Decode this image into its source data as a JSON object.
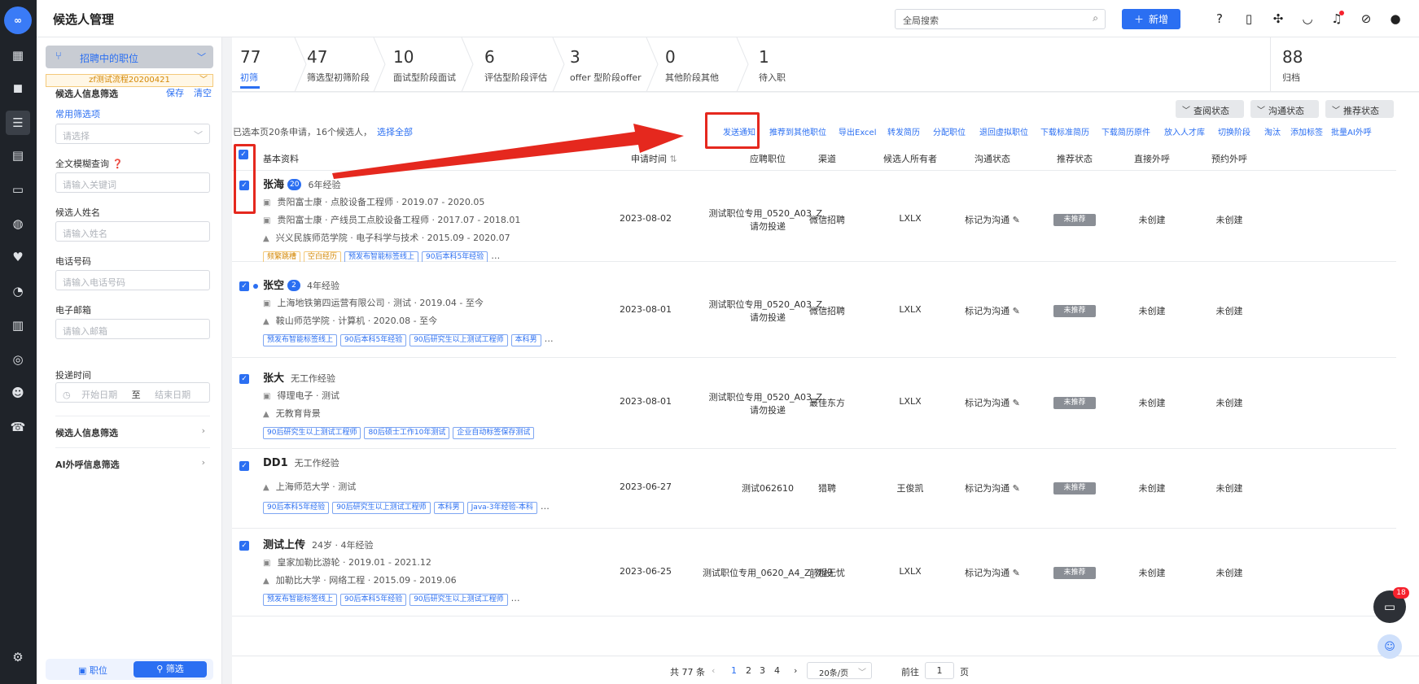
{
  "app": {
    "logo_text": "∞",
    "page_title": "候选人管理"
  },
  "rail": {
    "icons": [
      "dashboard-icon",
      "briefcase-icon",
      "resume-icon",
      "calendar-icon",
      "id-card-icon",
      "wechat-icon",
      "heart-icon",
      "pie-chart-icon",
      "bar-chart-icon",
      "compass-icon",
      "users-icon",
      "phone-icon",
      "settings-icon"
    ]
  },
  "topbar": {
    "search_placeholder": "全局搜索",
    "add_label": "新增",
    "icons": [
      "help-icon",
      "document-icon",
      "puzzle-icon",
      "headset-icon",
      "bell-icon",
      "link-icon",
      "user-icon"
    ]
  },
  "filter": {
    "job_selector": "招聘中的职位",
    "flow_tag": "zf测试流程20200421",
    "section_title": "候选人信息筛选",
    "save": "保存",
    "clear": "清空",
    "common_filters": "常用筛选项",
    "common_placeholder": "请选择",
    "fulltext_label": "全文模糊查询",
    "fulltext_placeholder": "请输入关键词",
    "name_label": "候选人姓名",
    "name_placeholder": "请输入姓名",
    "phone_label": "电话号码",
    "phone_placeholder": "请输入电话号码",
    "email_label": "电子邮箱",
    "email_placeholder": "请输入邮箱",
    "date_label": "投递时间",
    "date_start": "开始日期",
    "date_to": "至",
    "date_end": "结束日期",
    "section2": "候选人信息筛选",
    "section3": "AI外呼信息筛选",
    "bottom_tab_job": "职位",
    "bottom_tab_filter": "筛选"
  },
  "stages": [
    {
      "count": "77",
      "label": "初筛"
    },
    {
      "count": "47",
      "label": "筛选型初筛阶段"
    },
    {
      "count": "10",
      "label": "面试型阶段面试"
    },
    {
      "count": "6",
      "label": "评估型阶段评估"
    },
    {
      "count": "3",
      "label": "offer 型阶段offer"
    },
    {
      "count": "0",
      "label": "其他阶段其他"
    },
    {
      "count": "1",
      "label": "待入职"
    },
    {
      "count": "88",
      "label": "归档"
    }
  ],
  "status_filters": [
    "查阅状态",
    "沟通状态",
    "推荐状态"
  ],
  "selection": {
    "info": "已选本页20条申请，16个候选人，",
    "select_all": "选择全部"
  },
  "actions": [
    "发送通知",
    "推荐到其他职位",
    "导出Excel",
    "转发简历",
    "分配职位",
    "退回虚拟职位",
    "下载标准简历",
    "下载简历原件",
    "放入人才库",
    "切换阶段",
    "淘汰",
    "添加标签",
    "批量AI外呼"
  ],
  "columns": [
    "基本资料",
    "申请时间",
    "应聘职位",
    "渠道",
    "候选人所有者",
    "沟通状态",
    "推荐状态",
    "直接外呼",
    "预约外呼"
  ],
  "rows": [
    {
      "name": "张海",
      "badge": "20",
      "exp": "6年经验",
      "lines": [
        {
          "icon": "briefcase-icon",
          "text": "贵阳富士康 · 点胶设备工程师 · 2019.07 - 2020.05"
        },
        {
          "icon": "briefcase-icon",
          "text": "贵阳富士康 · 产线员工点胶设备工程师 · 2017.07 - 2018.01"
        },
        {
          "icon": "graduation-cap-icon",
          "text": "兴义民族师范学院 · 电子科学与技术 · 2015.09 - 2020.07"
        }
      ],
      "tags": [
        {
          "t": "频繁跳槽",
          "c": "or"
        },
        {
          "t": "空白经历",
          "c": "or"
        },
        {
          "t": "预发布智能标签线上",
          "c": ""
        },
        {
          "t": "90后本科5年经验",
          "c": ""
        }
      ],
      "date": "2023-08-02",
      "job": "测试职位专用_0520_A03_Z_请勿投递",
      "channel": "微信招聘",
      "owner": "LXLX",
      "comm": "标记为沟通",
      "rec": "未推荐",
      "direct": "未创建",
      "appt": "未创建"
    },
    {
      "name": "张空",
      "badge": "2",
      "exp": "4年经验",
      "lines": [
        {
          "icon": "briefcase-icon",
          "text": "上海地铁第四运营有限公司 · 测试 · 2019.04 - 至今"
        },
        {
          "icon": "graduation-cap-icon",
          "text": "鞍山师范学院 · 计算机 · 2020.08 - 至今"
        }
      ],
      "tags": [
        {
          "t": "预发布智能标签线上",
          "c": ""
        },
        {
          "t": "90后本科5年经验",
          "c": ""
        },
        {
          "t": "90后研究生以上测试工程师",
          "c": ""
        },
        {
          "t": "本科男",
          "c": ""
        }
      ],
      "date": "2023-08-01",
      "job": "测试职位专用_0520_A03_Z_请勿投递",
      "channel": "微信招聘",
      "owner": "LXLX",
      "comm": "标记为沟通",
      "rec": "未推荐",
      "direct": "未创建",
      "appt": "未创建"
    },
    {
      "name": "张大",
      "badge": "",
      "exp": "无工作经验",
      "lines": [
        {
          "icon": "briefcase-icon",
          "text": "得理电子 · 测试"
        },
        {
          "icon": "graduation-cap-icon",
          "text": "无教育背景"
        }
      ],
      "tags": [
        {
          "t": "90后研究生以上测试工程师",
          "c": ""
        },
        {
          "t": "80后硕士工作10年测试",
          "c": ""
        },
        {
          "t": "企业自动标签保存测试",
          "c": ""
        }
      ],
      "date": "2023-08-01",
      "job": "测试职位专用_0520_A03_Z_请勿投递",
      "channel": "最佳东方",
      "owner": "LXLX",
      "comm": "标记为沟通",
      "rec": "未推荐",
      "direct": "未创建",
      "appt": "未创建"
    },
    {
      "name": "DD1",
      "badge": "",
      "exp": "无工作经验",
      "lines": [
        {
          "icon": "graduation-cap-icon",
          "text": "上海师范大学 · 测试"
        }
      ],
      "tags": [
        {
          "t": "90后本科5年经验",
          "c": ""
        },
        {
          "t": "90后研究生以上测试工程师",
          "c": ""
        },
        {
          "t": "本科男",
          "c": ""
        },
        {
          "t": "Java-3年经验-本科",
          "c": ""
        }
      ],
      "date": "2023-06-27",
      "job": "测试062610",
      "channel": "猎聘",
      "owner": "王俊凯",
      "comm": "标记为沟通",
      "rec": "未推荐",
      "direct": "未创建",
      "appt": "未创建"
    },
    {
      "name": "测试上传",
      "badge": "",
      "exp": "24岁 · 4年经验",
      "lines": [
        {
          "icon": "briefcase-icon",
          "text": "皇家加勒比游轮 · 2019.01 - 2021.12"
        },
        {
          "icon": "graduation-cap-icon",
          "text": "加勒比大学 · 网络工程 · 2015.09 - 2019.06"
        }
      ],
      "tags": [
        {
          "t": "预发布智能标签线上",
          "c": ""
        },
        {
          "t": "90后本科5年经验",
          "c": ""
        },
        {
          "t": "90后研究生以上测试工程师",
          "c": ""
        }
      ],
      "date": "2023-06-25",
      "job": "测试职位专用_0620_A4_Z_勿投",
      "channel": "前程无忧",
      "owner": "LXLX",
      "comm": "标记为沟通",
      "rec": "未推荐",
      "direct": "未创建",
      "appt": "未创建"
    }
  ],
  "pager": {
    "total": "共 77 条",
    "pages": [
      "1",
      "2",
      "3",
      "4"
    ],
    "page_size": "20条/页",
    "goto": "前往",
    "goto_value": "1",
    "page_unit": "页"
  },
  "chat": {
    "count": "18"
  }
}
